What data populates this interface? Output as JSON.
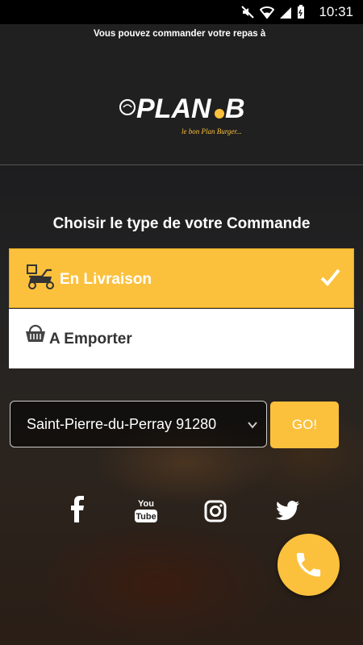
{
  "status": {
    "time": "10:31"
  },
  "header": {
    "marquee": "Vous pouvez commander votre repas à",
    "logo_text": "PLAN.B",
    "logo_tagline": "le bon Plan Burger..."
  },
  "main": {
    "title": "Choisir le type de votre Commande",
    "options": [
      {
        "label": "En Livraison",
        "icon": "scooter-icon",
        "selected": true
      },
      {
        "label": "A Emporter",
        "icon": "basket-icon",
        "selected": false
      }
    ],
    "location_select": {
      "value": "Saint-Pierre-du-Perray 91280"
    },
    "go_button": "GO!"
  },
  "social": {
    "youtube_label_top": "You",
    "youtube_label_bottom": "Tube"
  },
  "colors": {
    "accent": "#fbc13d",
    "header_bg": "#202020"
  }
}
